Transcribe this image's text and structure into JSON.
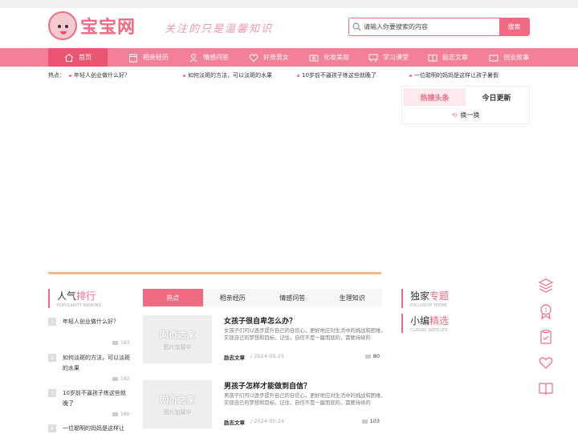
{
  "header": {
    "logo_text": "宝宝网",
    "slogan": "关注的只是温馨知识",
    "search": {
      "placeholder": "请输入你要搜索的内容",
      "button_label": "搜索"
    }
  },
  "nav": {
    "items": [
      {
        "label": "首页",
        "icon": "home-icon"
      },
      {
        "label": "相亲经历",
        "icon": "calendar-icon"
      },
      {
        "label": "情感问答",
        "icon": "qa-icon"
      },
      {
        "label": "好奇男女",
        "icon": "heart-icon"
      },
      {
        "label": "化妆美容",
        "icon": "cosmetics-icon"
      },
      {
        "label": "学习课堂",
        "icon": "desk-icon"
      },
      {
        "label": "励志文章",
        "icon": "book-icon"
      },
      {
        "label": "创业故事",
        "icon": "open-book-icon"
      }
    ]
  },
  "hotbar": {
    "label": "热点：",
    "items": [
      "年轻人创业做什么好？",
      "如何淡斑的方法，可以淡斑的水果",
      "10岁前不逼孩子练这些就晚了",
      "一位聪明的妈妈是这样让孩子暑假"
    ]
  },
  "hotbox": {
    "tabs": [
      "热搜头条",
      "今日更新"
    ],
    "refresh": "换一换"
  },
  "ranking": {
    "title_a": "人气",
    "title_b": "排行",
    "subtitle": "POPULARITY RANKING",
    "items": [
      {
        "num": "1",
        "title": "年轻人创业做什么好？",
        "views": "183"
      },
      {
        "num": "2",
        "title": "如何淡斑的方法，可以淡斑的水果",
        "views": "182"
      },
      {
        "num": "3",
        "title": "10岁前不逼孩子练这些就晚了",
        "views": "180"
      },
      {
        "num": "4",
        "title": "一位聪明的妈妈是这样让",
        "views": ""
      }
    ]
  },
  "content_tabs": [
    "热点",
    "相亲经历",
    "情感问答",
    "生理知识"
  ],
  "articles": [
    {
      "thumb_title": "网页之家",
      "thumb_sub": "图片加载中",
      "title": "女孩子很自卑怎么办？",
      "desc": "女孩子们可以逐步提升自己的自信心，更好地应对生活中的挑战和困难，实现自己的梦想和目标。记住，自信不是一蹴而就的，需要持续的",
      "category": "励志文章",
      "date": "2024-05-25",
      "views": "80"
    },
    {
      "thumb_title": "网页之家",
      "thumb_sub": "图片加载中",
      "title": "男孩子怎样才能做到自信？",
      "desc": "男孩子们可以逐步提升自己的自信心，更好地应对生活中的挑战和困难，实现自己的梦想和目标。记住，自信不是一蹴而就的，需要持续的",
      "category": "励志文章",
      "date": "2024-05-24",
      "views": "103"
    }
  ],
  "right_sections": [
    {
      "title_a": "独家",
      "title_b": "专题",
      "subtitle": "EXCLUSIVE THEME"
    },
    {
      "title_a": "小编",
      "title_b": "精选",
      "subtitle": "CLASSIC ARTICLES"
    }
  ],
  "side_icons": [
    "layers-icon",
    "medal-icon",
    "clipboard-icon",
    "heart-hand-icon",
    "book-icon"
  ],
  "colors": {
    "accent": "#f06a82",
    "nav_bg": "#f47f96",
    "nav_active": "#ec5572",
    "divider": "#f6b98b"
  }
}
